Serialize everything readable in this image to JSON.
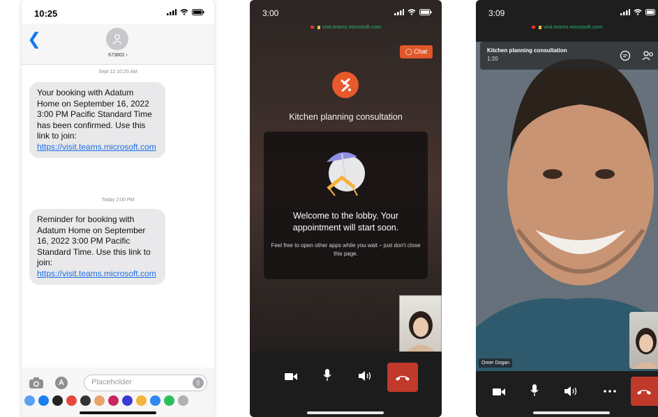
{
  "messages": {
    "status_time": "10:25",
    "contact_name": "673802",
    "thread": [
      {
        "timestamp": "Sept 12 10:25 AM",
        "text": "Your booking with Adatum Home on September 16, 2022 3:00 PM Pacific Standard Time has been confirmed. Use this link to join:",
        "link": "https://visit.teams.microsoft.com"
      },
      {
        "timestamp": "Today 2:00 PM",
        "text": "Reminder for booking with Adatum Home on September 16, 2022 3:00 PM Pacific Standard Time. Use this link to join:",
        "link": "https://visit.teams.microsoft.com"
      }
    ],
    "composer_placeholder": "Placeholder"
  },
  "lobby": {
    "status_time": "3:00",
    "url": "visit.teams.microsoft.com",
    "chat_label": "Chat",
    "meeting_title": "Kitchen planning consultation",
    "welcome": "Welcome to the lobby. Your appointment will start soon.",
    "subtext": "Feel free to open other apps while you wait – just don't close this page."
  },
  "call": {
    "status_time": "3:09",
    "url": "visit.teams.microsoft.com",
    "meeting_title": "Kitchen planning consultation",
    "duration": "1:20",
    "participant_name": "Omer Dogan"
  },
  "colors": {
    "imessage_link": "#1b6ee6",
    "teams_orange": "#e8592b",
    "hangup_red": "#c0392b"
  }
}
